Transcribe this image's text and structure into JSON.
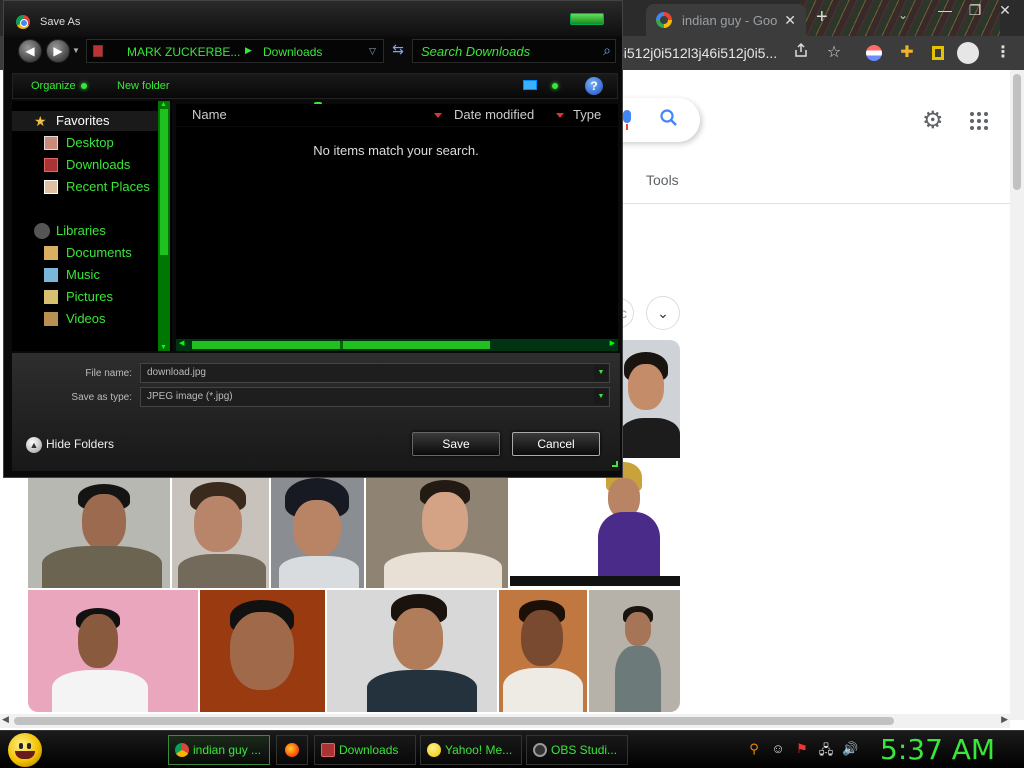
{
  "browser": {
    "tab_title": "indian guy - Goo",
    "tab_close": "✕",
    "new_tab": "+",
    "tab_search": "⌄",
    "url_fragment": "8i512j0i512l3j46i512j0i5...",
    "window_controls": [
      "—",
      "❐",
      "✕"
    ],
    "tools_label": "Tools",
    "chip_partial_text": "c",
    "accent_colors": {
      "chrome_dark": "#3c3c3c",
      "google_blue": "#4285f4"
    }
  },
  "dialog": {
    "title": "Save As",
    "breadcrumb": [
      "MARK ZUCKERBE...",
      "Downloads"
    ],
    "breadcrumb_separator": "▶",
    "search_placeholder": "Search Downloads",
    "commands": {
      "organize": "Organize",
      "new_folder": "New folder"
    },
    "help_symbol": "?",
    "navigation": {
      "favorites_label": "Favorites",
      "favorites": [
        "Desktop",
        "Downloads",
        "Recent Places"
      ],
      "libraries_label": "Libraries",
      "libraries": [
        "Documents",
        "Music",
        "Pictures",
        "Videos"
      ]
    },
    "columns": [
      "Name",
      "Date modified",
      "Type"
    ],
    "empty_message": "No items match your search.",
    "file_name_label": "File name:",
    "file_name_value": "download.jpg",
    "save_type_label": "Save as type:",
    "save_type_value": "JPEG image (*.jpg)",
    "hide_folders": "Hide Folders",
    "save_button": "Save",
    "cancel_button": "Cancel",
    "theme_color": "#39e639"
  },
  "taskbar": {
    "items": [
      {
        "label": "indian guy ...",
        "icon": "chrome-icon"
      },
      {
        "label": "",
        "icon": "firefox-icon"
      },
      {
        "label": "Downloads",
        "icon": "folder-icon"
      },
      {
        "label": "Yahoo! Me...",
        "icon": "yahoo-messenger-icon"
      },
      {
        "label": "OBS Studi...",
        "icon": "obs-icon"
      }
    ],
    "clock": "5:37 AM"
  }
}
